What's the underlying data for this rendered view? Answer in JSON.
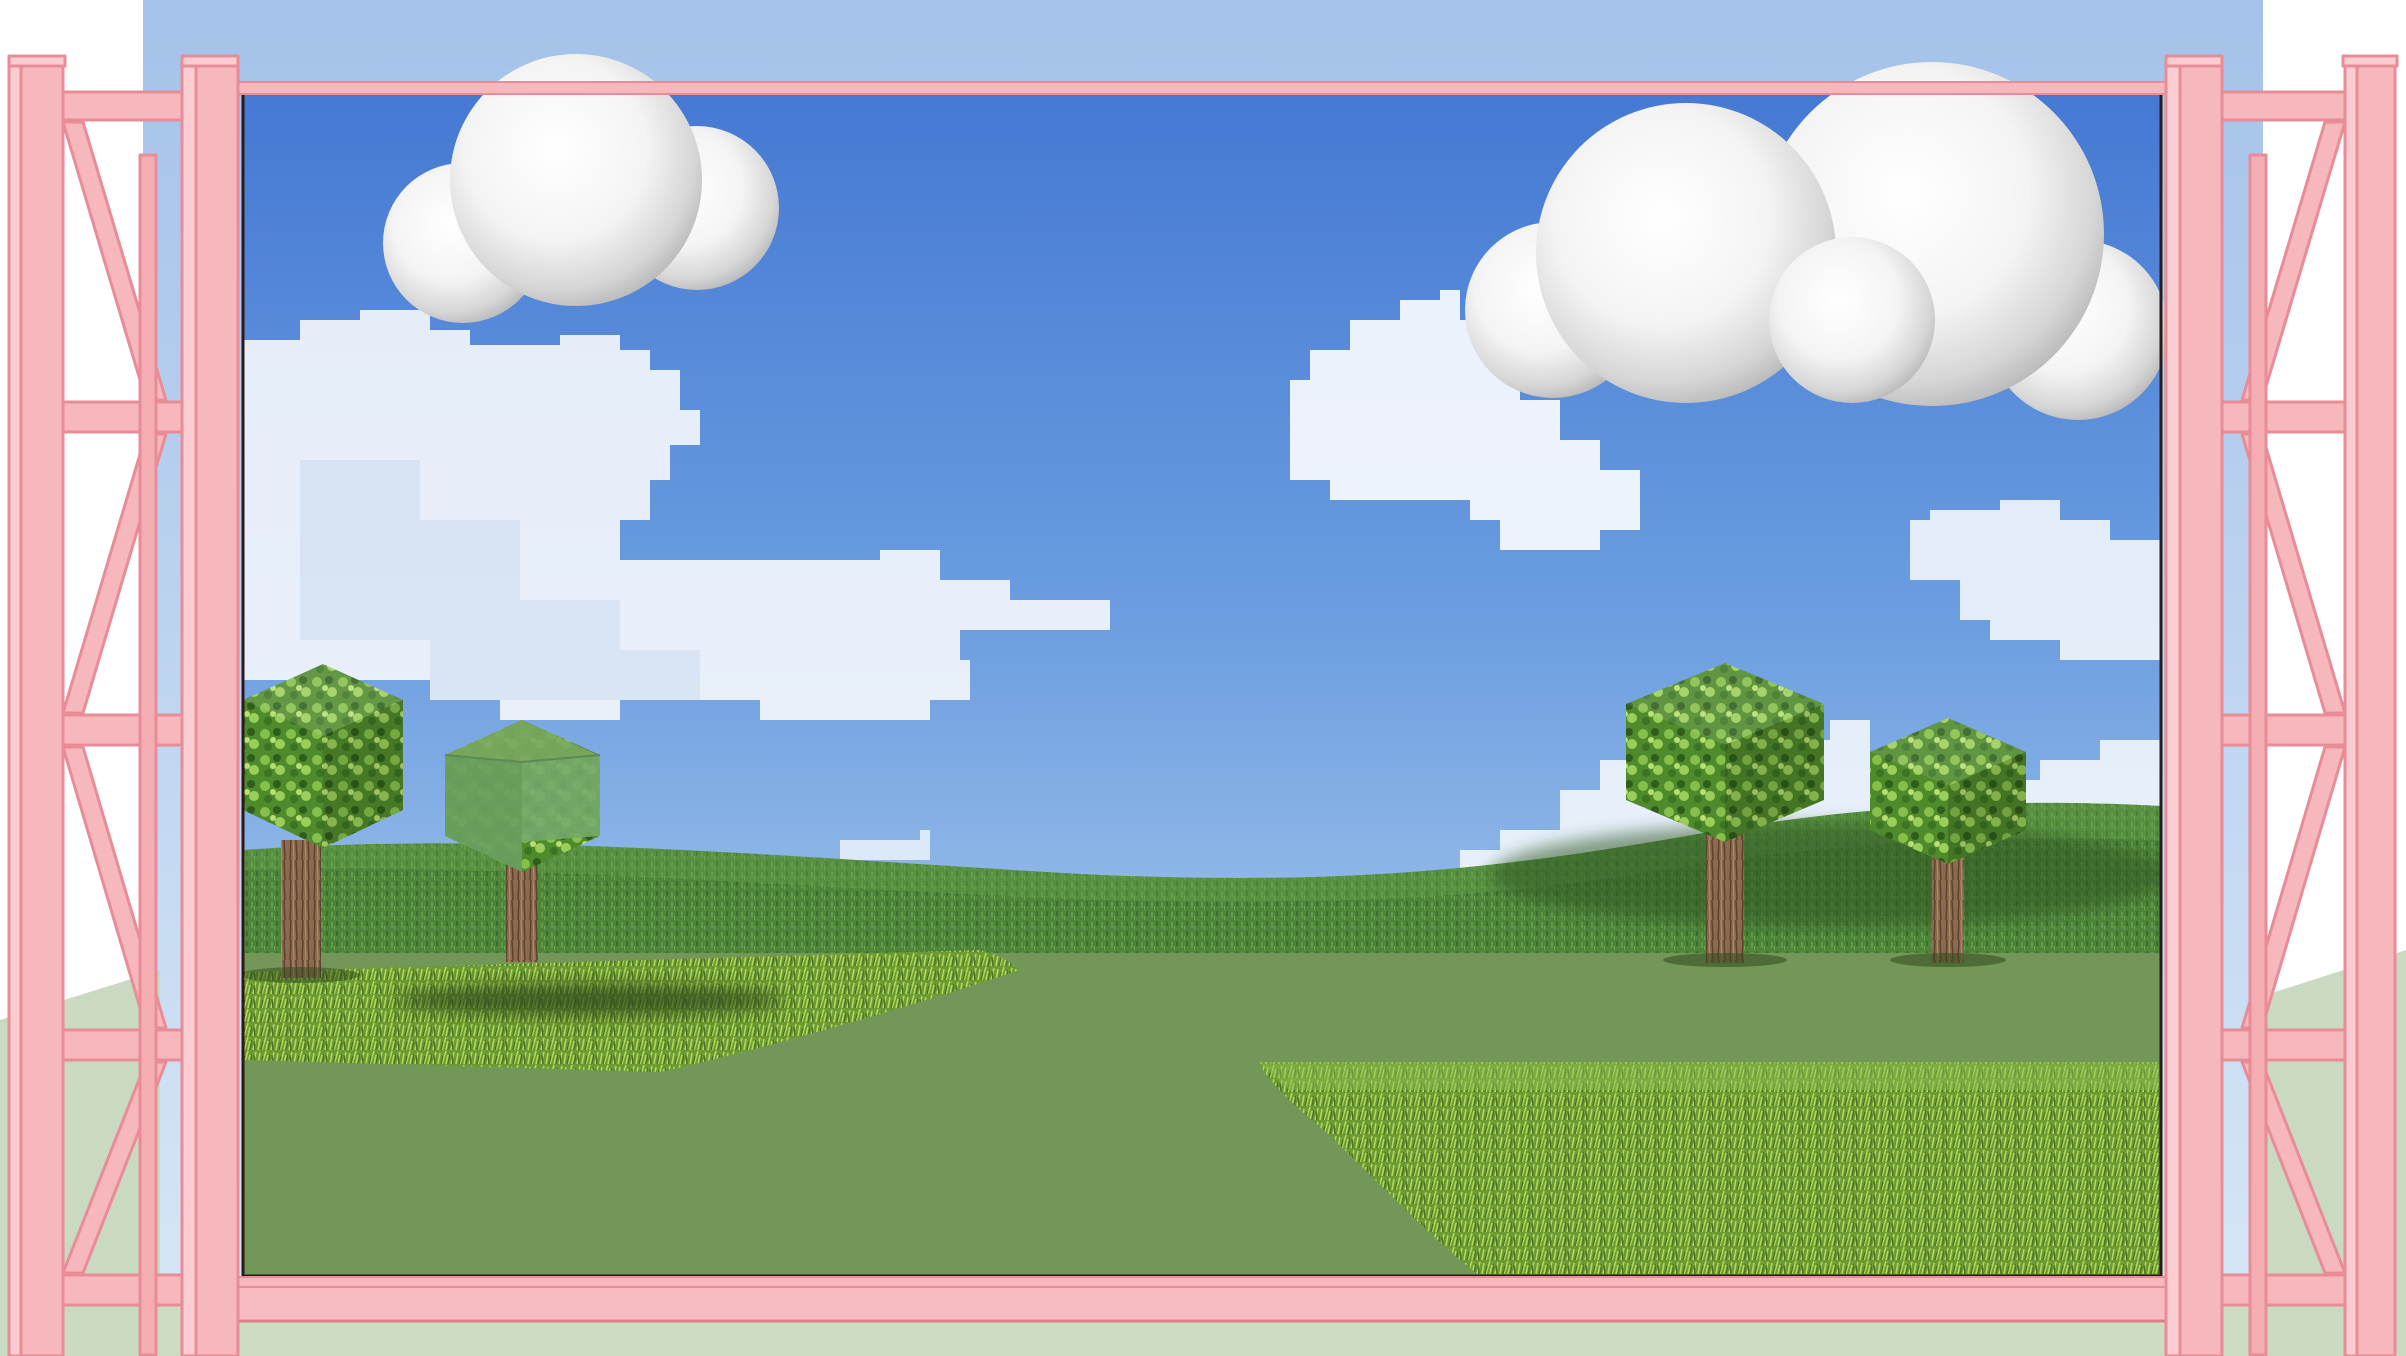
{
  "scene": {
    "kind": "3d-playground-viewport",
    "text_content": [],
    "colors": {
      "sky_top": "#4a83d6",
      "sky_horizon": "#b8d4f0",
      "backdrop_sky": "#aac6ec",
      "frame_pink": "#f6b8bd",
      "frame_pink_edge": "#e98f98",
      "hill_green": "#4f8a3c",
      "ground_green": "#739758",
      "grass_bright": "#7fae3b",
      "foliage_green": "#5e9a32",
      "trunk_brown": "#8a6a4a",
      "cloud_white": "#ffffff"
    },
    "objects": {
      "clouds_3d": 2,
      "pixel_clouds": 5,
      "trees": 4,
      "selected_cube_highlighted": true,
      "grass_patches": 2
    },
    "icons": [
      "pink-scaffold-frame-left",
      "pink-scaffold-frame-right"
    ]
  }
}
